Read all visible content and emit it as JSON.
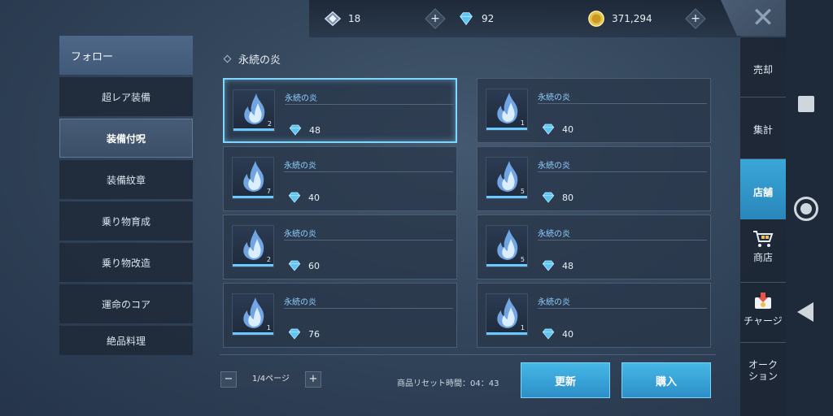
{
  "currency": {
    "crystal": "18",
    "gems": "92",
    "gold": "371,294"
  },
  "left_menu": [
    {
      "label": "フォロー"
    },
    {
      "label": "超レア装備"
    },
    {
      "label": "装備付呪"
    },
    {
      "label": "装備紋章"
    },
    {
      "label": "乗り物育成"
    },
    {
      "label": "乗り物改造"
    },
    {
      "label": "運命のコア"
    },
    {
      "label": "絶品料理"
    }
  ],
  "section_title": "永続の炎",
  "items": [
    {
      "name": "永続の炎",
      "qty": "2",
      "price": "48"
    },
    {
      "name": "永続の炎",
      "qty": "1",
      "price": "40"
    },
    {
      "name": "永続の炎",
      "qty": "7",
      "price": "40"
    },
    {
      "name": "永続の炎",
      "qty": "5",
      "price": "80"
    },
    {
      "name": "永続の炎",
      "qty": "2",
      "price": "60"
    },
    {
      "name": "永続の炎",
      "qty": "5",
      "price": "48"
    },
    {
      "name": "永続の炎",
      "qty": "1",
      "price": "76"
    },
    {
      "name": "永続の炎",
      "qty": "1",
      "price": "40"
    }
  ],
  "pager": {
    "label": "1/4ページ",
    "minus": "−",
    "plus": "+"
  },
  "reset_time": "商品リセット時間：04：43",
  "buttons": {
    "refresh": "更新",
    "buy": "購入"
  },
  "right_nav": {
    "sell": "売却",
    "gather": "集計",
    "store": "店舗",
    "shop": "商店",
    "charge": "チャージ",
    "auction_line1": "オーク",
    "auction_line2": "ション"
  },
  "colors": {
    "accent": "#3aa7d8",
    "item_name": "#8fd0ff",
    "selected_border": "#7fd6ff"
  }
}
